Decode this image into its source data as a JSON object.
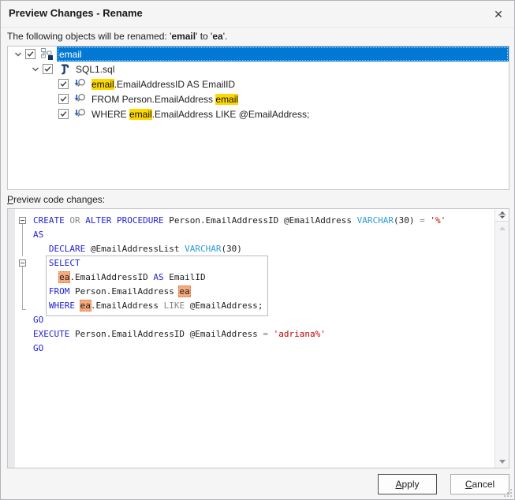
{
  "dialog": {
    "title": "Preview Changes - Rename",
    "close_icon": "✕"
  },
  "subtitle": {
    "segments": [
      {
        "t": "The following objects will be renamed: '"
      },
      {
        "t": "email",
        "b": true
      },
      {
        "t": "' to '"
      },
      {
        "t": "ea",
        "b": true
      },
      {
        "t": "'."
      }
    ]
  },
  "tree": {
    "rows": [
      {
        "level": 0,
        "expanded": true,
        "checked": true,
        "icon": "schema-objects-icon",
        "selected": true,
        "segments": [
          {
            "t": "email"
          }
        ]
      },
      {
        "level": 1,
        "expanded": true,
        "checked": true,
        "icon": "sql-script-icon",
        "segments": [
          {
            "t": "SQL1.sql"
          }
        ]
      },
      {
        "level": 2,
        "checked": true,
        "icon": "find-reference-icon",
        "segments": [
          {
            "t": "email",
            "hl": true
          },
          {
            "t": ".EmailAddressID AS EmailID"
          }
        ]
      },
      {
        "level": 2,
        "checked": true,
        "icon": "find-reference-icon",
        "segments": [
          {
            "t": "FROM Person.EmailAddress "
          },
          {
            "t": "email",
            "hl": true
          }
        ]
      },
      {
        "level": 2,
        "checked": true,
        "icon": "find-reference-icon",
        "segments": [
          {
            "t": "WHERE "
          },
          {
            "t": "email",
            "hl": true
          },
          {
            "t": ".EmailAddress LIKE @EmailAddress;"
          }
        ]
      }
    ]
  },
  "code_label": "Preview code changes:",
  "code": {
    "lines": [
      {
        "outline": "box",
        "segments": [
          {
            "t": "CREATE",
            "c": "kw"
          },
          {
            "t": " "
          },
          {
            "t": "OR",
            "c": "op"
          },
          {
            "t": " "
          },
          {
            "t": "ALTER",
            "c": "kw"
          },
          {
            "t": " "
          },
          {
            "t": "PROCEDURE",
            "c": "kw"
          },
          {
            "t": " Person.EmailAddressID @EmailAddress "
          },
          {
            "t": "VARCHAR",
            "c": "type"
          },
          {
            "t": "(30) "
          },
          {
            "t": "=",
            "c": "op"
          },
          {
            "t": " "
          },
          {
            "t": "'%'",
            "c": "str"
          }
        ]
      },
      {
        "outline": "line",
        "segments": [
          {
            "t": "AS",
            "c": "kw"
          }
        ]
      },
      {
        "outline": "line",
        "segments": [
          {
            "t": "   "
          },
          {
            "t": "DECLARE",
            "c": "kw"
          },
          {
            "t": " @EmailAddressList "
          },
          {
            "t": "VARCHAR",
            "c": "type"
          },
          {
            "t": "(30)"
          }
        ]
      },
      {
        "outline": "box",
        "segments": [
          {
            "t": "   "
          },
          {
            "t": "SELECT",
            "c": "kw"
          }
        ]
      },
      {
        "outline": "line",
        "segments": [
          {
            "t": "     "
          },
          {
            "t": "ea",
            "hl": true
          },
          {
            "t": ".EmailAddressID "
          },
          {
            "t": "AS",
            "c": "kw"
          },
          {
            "t": " EmailID"
          }
        ]
      },
      {
        "outline": "line",
        "segments": [
          {
            "t": "   "
          },
          {
            "t": "FROM",
            "c": "kw"
          },
          {
            "t": " Person.EmailAddress "
          },
          {
            "t": "ea",
            "hl": true
          }
        ]
      },
      {
        "outline": "end",
        "segments": [
          {
            "t": "   "
          },
          {
            "t": "WHERE",
            "c": "kw"
          },
          {
            "t": " "
          },
          {
            "t": "ea",
            "hl": true
          },
          {
            "t": ".EmailAddress "
          },
          {
            "t": "LIKE",
            "c": "op"
          },
          {
            "t": " @EmailAddress"
          },
          {
            "t": ";"
          }
        ]
      },
      {
        "outline": "",
        "segments": [
          {
            "t": "GO",
            "c": "kw"
          }
        ]
      },
      {
        "outline": "",
        "segments": [
          {
            "t": "EXECUTE",
            "c": "kw"
          },
          {
            "t": " Person.EmailAddressID @EmailAddress "
          },
          {
            "t": "=",
            "c": "op"
          },
          {
            "t": " "
          },
          {
            "t": "'adriana%'",
            "c": "str"
          }
        ]
      },
      {
        "outline": "",
        "segments": [
          {
            "t": "GO",
            "c": "kw"
          }
        ]
      }
    ]
  },
  "buttons": {
    "apply": "Apply",
    "cancel": "Cancel"
  },
  "colors": {
    "selection_blue": "#0078D4",
    "tree_match_highlight": "#FFD800",
    "code_match_highlight": "#F7A97F",
    "keyword": "#2222D4",
    "operator": "#878787",
    "datatype": "#2E9BD5",
    "string": "#C00000"
  }
}
